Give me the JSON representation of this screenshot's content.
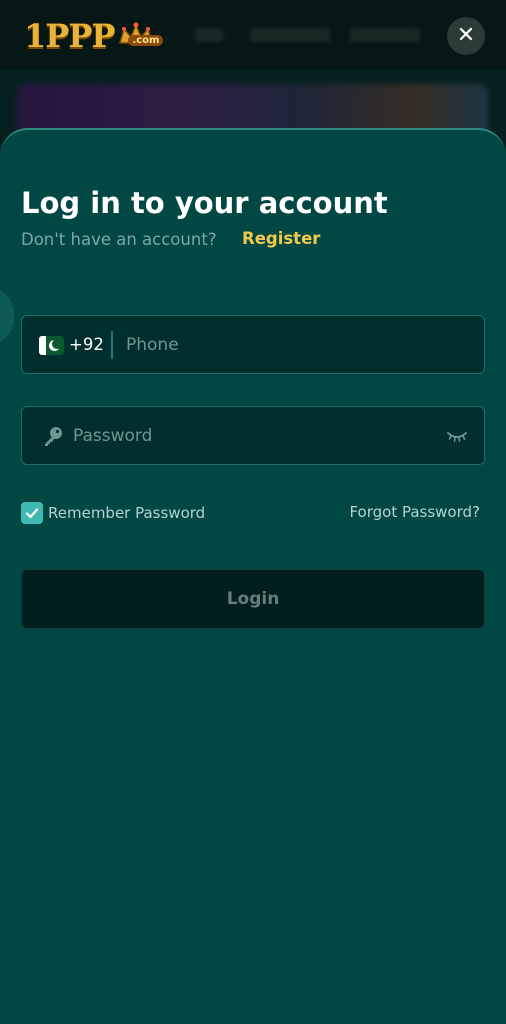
{
  "header": {
    "logo_text": "1PPP",
    "logo_suffix": ".com",
    "close_label": "✕"
  },
  "login": {
    "title": "Log in to your account",
    "no_account_text": "Don't have an account?",
    "register_label": "Register",
    "country_code": "+92",
    "country_flag": "pakistan-flag-icon",
    "phone_placeholder": "Phone",
    "password_placeholder": "Password",
    "remember_label": "Remember Password",
    "remember_checked": true,
    "forgot_label": "Forgot Password?",
    "login_label": "Login"
  },
  "colors": {
    "sheet_bg": "#014744",
    "accent": "#f2c94c",
    "checkbox": "#3fb9b2"
  }
}
